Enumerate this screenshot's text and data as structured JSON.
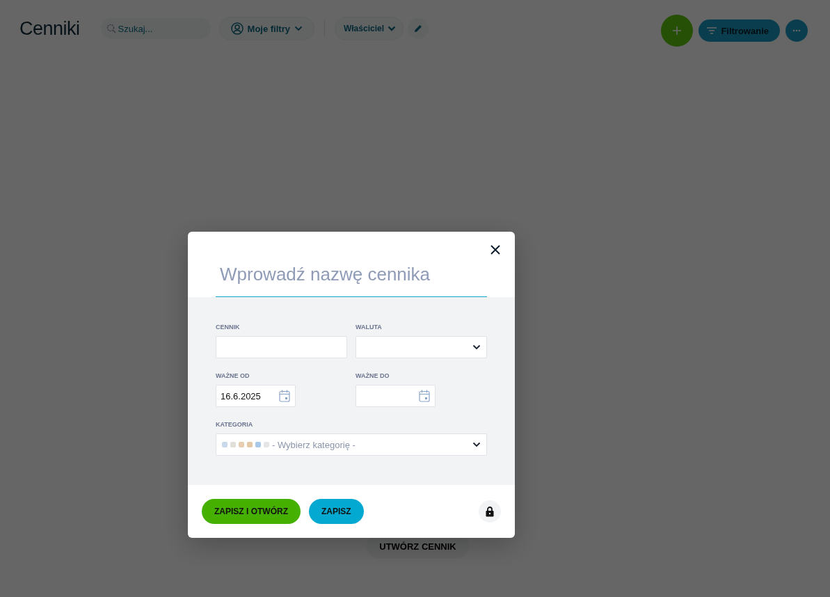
{
  "header": {
    "title": "Cenniki",
    "search": {
      "placeholder": "Szukaj..."
    },
    "my_filters": "Moje filtry",
    "owner_filter": "Właściciel",
    "filter_button": "Filtrowanie"
  },
  "empty_state": {
    "create_button": "UTWÓRZ CENNIK"
  },
  "modal": {
    "name_field": {
      "placeholder": "Wprowadź nazwę cennika"
    },
    "fields": [
      {
        "kind": "text",
        "label": "CENNIK"
      },
      {
        "kind": "select",
        "label": "WALUTA"
      },
      {
        "kind": "date",
        "label": "WAŻNE OD",
        "value": "16.6.2025"
      },
      {
        "kind": "date",
        "label": "WAŻNE DO"
      }
    ],
    "category": {
      "label": "KATEGORIA",
      "placeholder": "- Wybierz kategorię -",
      "swatches": [
        {
          "color": "#c9d9ec"
        },
        {
          "color": "#e2ded8"
        },
        {
          "color": "#e8cdb0"
        },
        {
          "color": "#e5c8a6"
        },
        {
          "color": "#a8c9ea"
        },
        {
          "color": "#e3e5e8"
        }
      ]
    },
    "buttons": [
      {
        "kind": "primary",
        "label": "ZAPISZ I OTWÓRZ"
      },
      {
        "kind": "secondary",
        "label": "ZAPISZ"
      }
    ]
  }
}
